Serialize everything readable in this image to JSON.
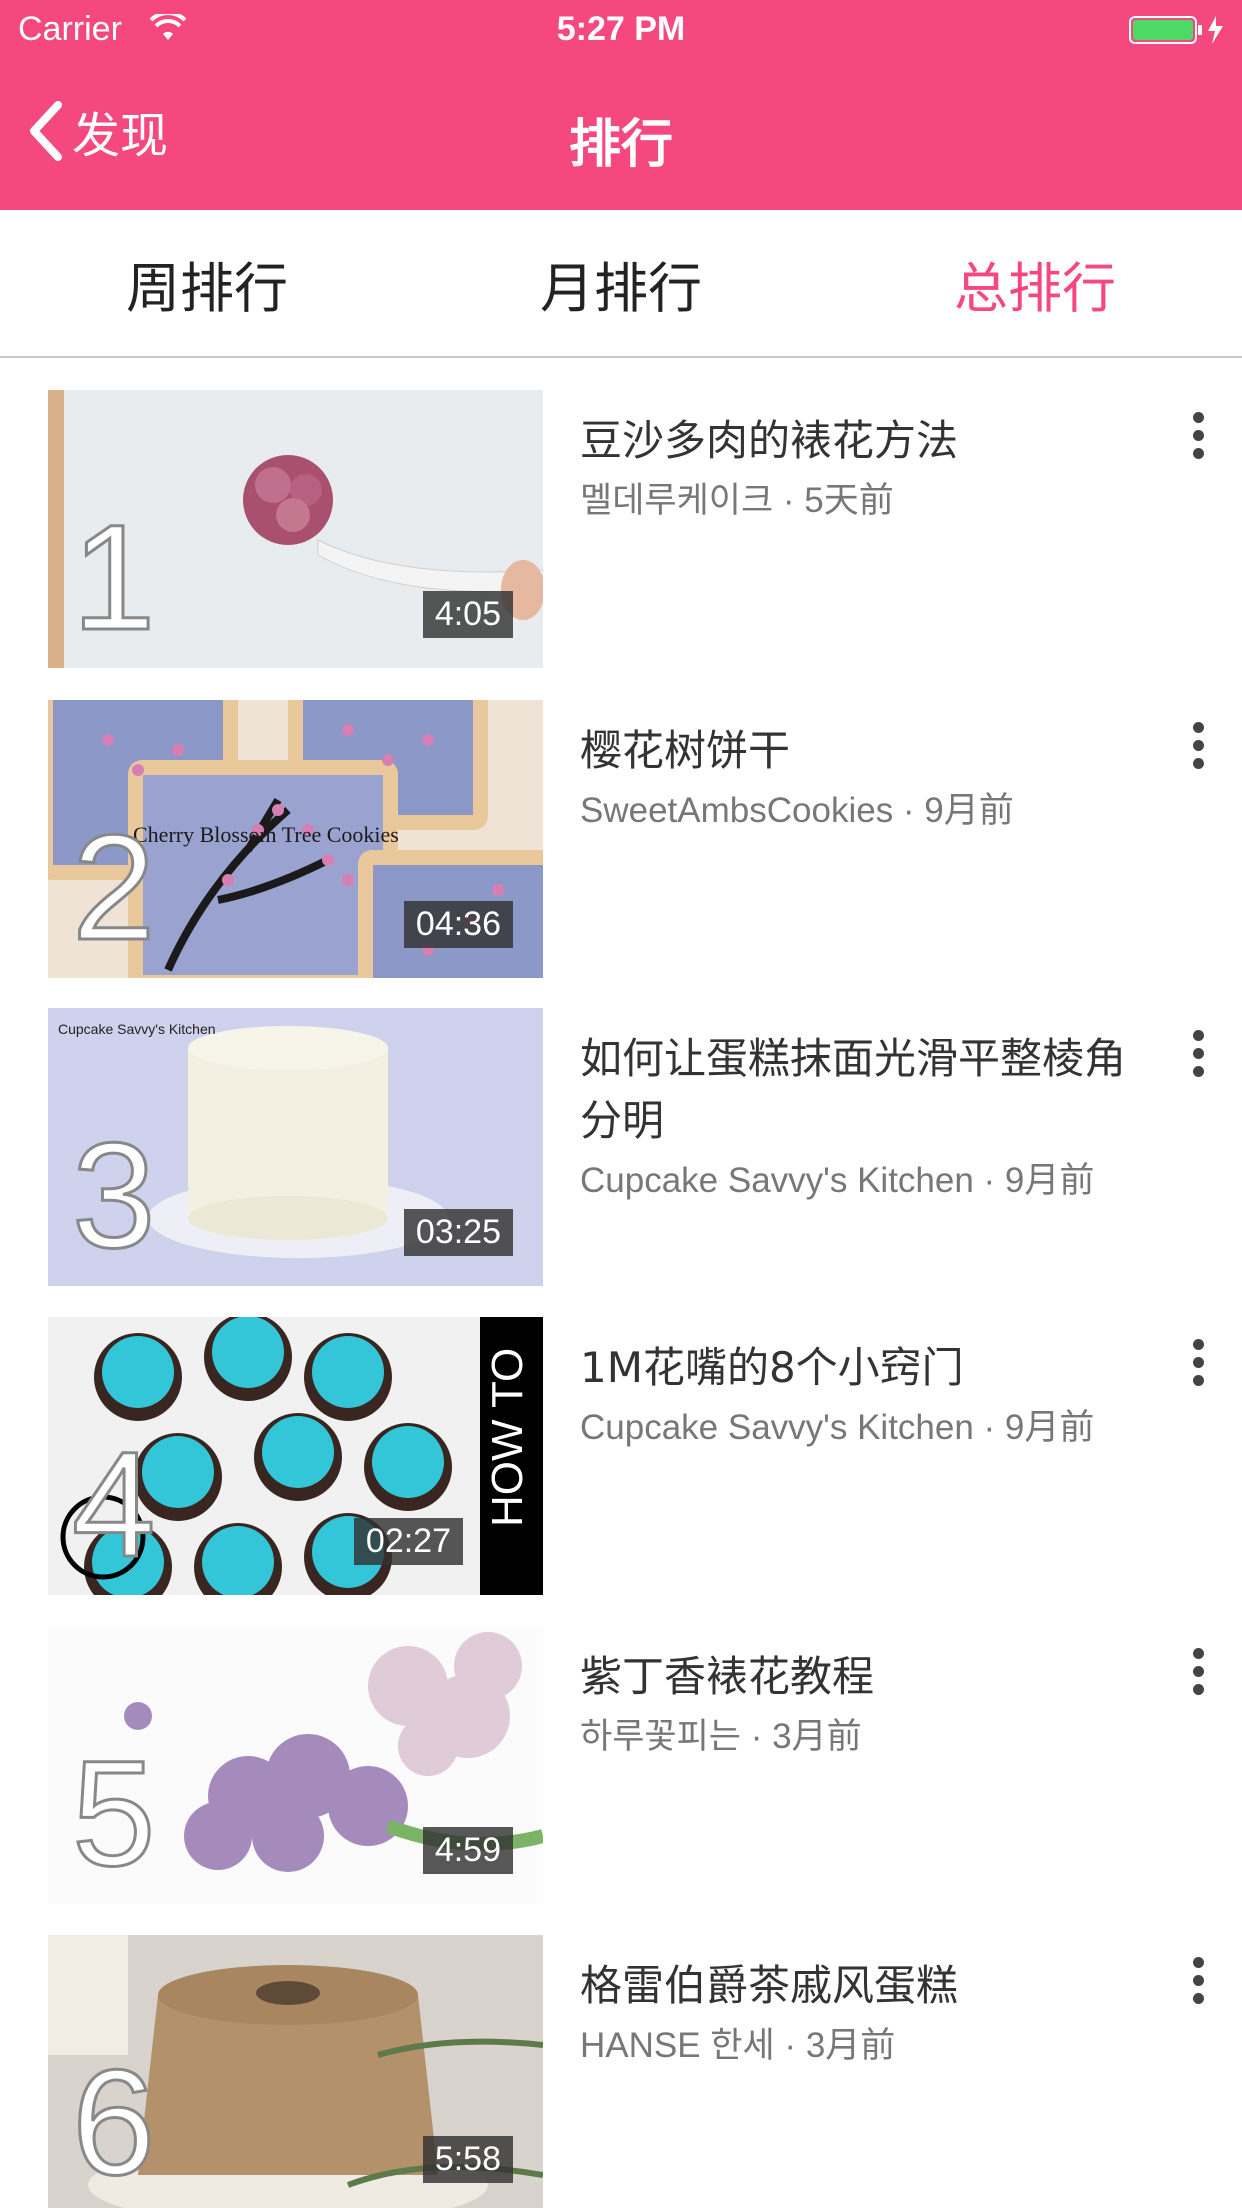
{
  "status_bar": {
    "carrier": "Carrier",
    "time": "5:27 PM"
  },
  "nav": {
    "back_label": "发现",
    "title": "排行"
  },
  "tabs": [
    {
      "label": "周排行"
    },
    {
      "label": "月排行"
    },
    {
      "label": "总排行",
      "active": true
    }
  ],
  "colors": {
    "accent": "#f5487f"
  },
  "videos": [
    {
      "rank": "1",
      "duration": "4:05",
      "title": "豆沙多肉的裱花方法",
      "meta": "멜데루케이크 · 5天前"
    },
    {
      "rank": "2",
      "duration": "04:36",
      "title": "樱花树饼干",
      "meta": "SweetAmbsCookies · 9月前",
      "thumb_text": "Cherry Blossom Tree Cookies"
    },
    {
      "rank": "3",
      "duration": "03:25",
      "title": "如何让蛋糕抹面光滑平整棱角分明",
      "meta": "Cupcake Savvy's Kitchen · 9月前",
      "thumb_text": "Cupcake Savvy's Kitchen"
    },
    {
      "rank": "4",
      "duration": "02:27",
      "title": "1M花嘴的8个小窍门",
      "meta": "Cupcake Savvy's Kitchen · 9月前",
      "thumb_text": "HOW TO"
    },
    {
      "rank": "5",
      "duration": "4:59",
      "title": "紫丁香裱花教程",
      "meta": "하루꽃피는 · 3月前"
    },
    {
      "rank": "6",
      "duration": "5:58",
      "title": "格雷伯爵茶戚风蛋糕",
      "meta": "HANSE 한세 · 3月前"
    }
  ]
}
